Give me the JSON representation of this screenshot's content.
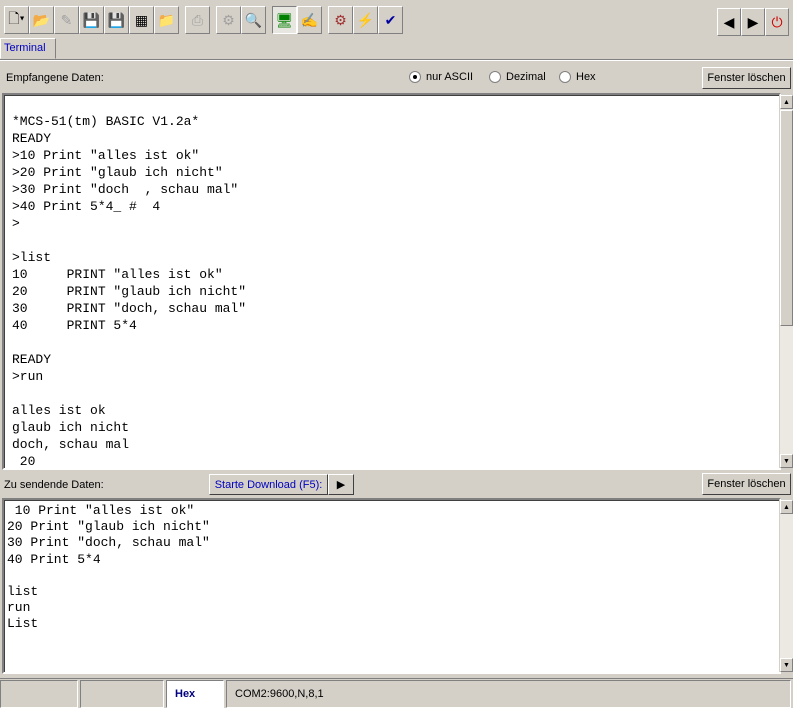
{
  "toolbar": {
    "icons": [
      "new-document-icon",
      "open-icon",
      "open-disabled-icon",
      "save-disabled-icon",
      "save-as-icon",
      "save-all-icon",
      "export-icon",
      "print-icon",
      "settings-disabled-icon",
      "preview-icon",
      "terminal-monitor-icon",
      "edit-icon",
      "compile-icon",
      "flash-icon",
      "check-icon"
    ],
    "right": [
      "arrow-left-icon",
      "arrow-right-icon",
      "power-icon"
    ]
  },
  "tabs": [
    {
      "label": "Terminal"
    }
  ],
  "receive": {
    "label": "Empfangene Daten:",
    "radios": [
      {
        "label": "nur ASCII",
        "checked": true
      },
      {
        "label": "Dezimal",
        "checked": false
      },
      {
        "label": "Hex",
        "checked": false
      }
    ],
    "clear_label": "Fenster löschen",
    "text": "*MCS-51(tm) BASIC V1.2a*\nREADY\n>10 Print \"alles ist ok\"\n>20 Print \"glaub ich nicht\"\n>30 Print \"doch  , schau mal\"\n>40 Print 5*4_ #  4\n>\n\n>list\n10     PRINT \"alles ist ok\"\n20     PRINT \"glaub ich nicht\"\n30     PRINT \"doch, schau mal\"\n40     PRINT 5*4\n\nREADY\n>run\n\nalles ist ok\nglaub ich nicht\ndoch, schau mal\n 20"
  },
  "send": {
    "label": "Zu sendende Daten:",
    "download_label": "Starte Download (F5):",
    "clear_label": "Fenster löschen",
    "text": " 10 Print \"alles ist ok\"\n20 Print \"glaub ich nicht\"\n30 Print \"doch, schau mal\"\n40 Print 5*4\n\nlist\nrun\nList"
  },
  "status": {
    "mode": "Hex",
    "port": "COM2:9600,N,8,1"
  }
}
